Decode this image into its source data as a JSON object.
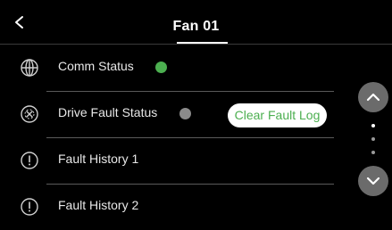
{
  "header": {
    "title": "Fan 01"
  },
  "rows": [
    {
      "label": "Comm Status",
      "icon": "globe-icon",
      "status_color": "#4caf50"
    },
    {
      "label": "Drive Fault Status",
      "icon": "fault-x-icon",
      "status_color": "#8a8a8a"
    },
    {
      "label": "Fault History 1",
      "icon": "alert-icon"
    },
    {
      "label": "Fault History 2",
      "icon": "alert-icon"
    }
  ],
  "clear_fault_button": {
    "label": "Clear Fault Log",
    "color": "#4caf50"
  },
  "scroll": {
    "up_icon": "chevron-up-icon",
    "down_icon": "chevron-down-icon",
    "pages": 3,
    "current_page": 1
  },
  "colors": {
    "background": "#000000",
    "text": "#ffffff",
    "divider": "#5a5a5a",
    "accent_green": "#4caf50"
  }
}
